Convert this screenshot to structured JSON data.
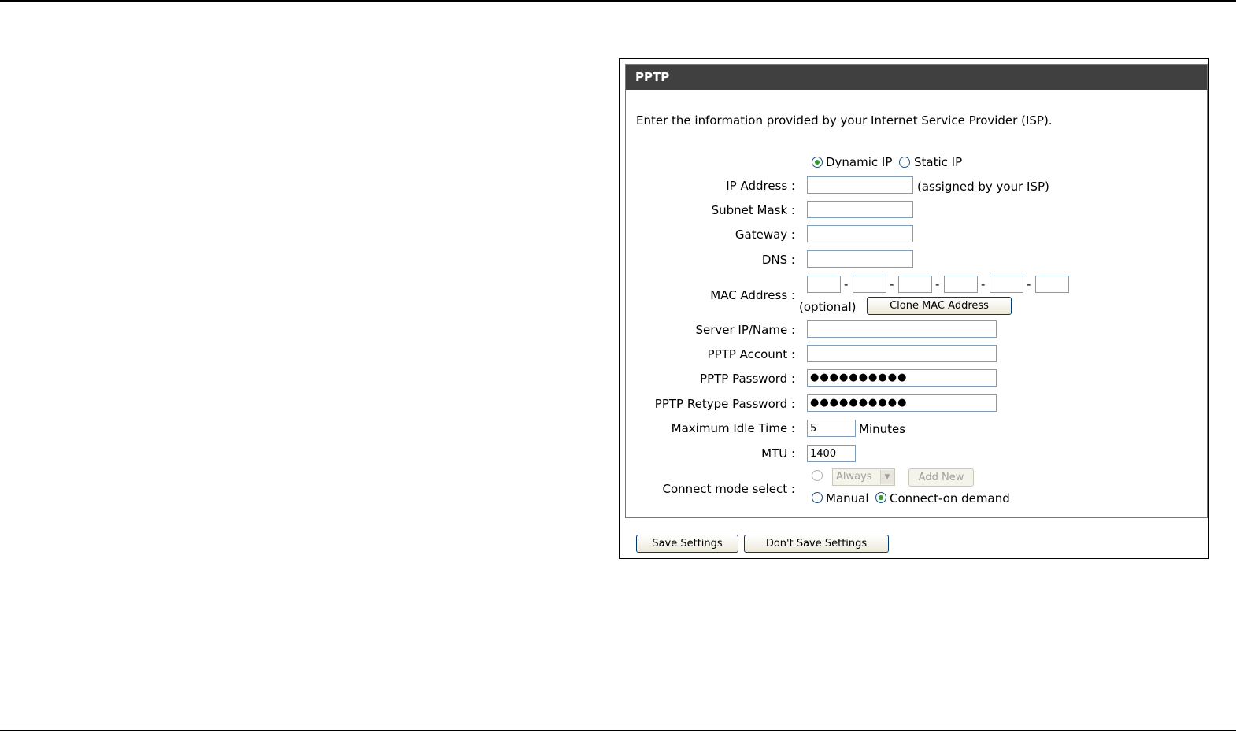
{
  "panel": {
    "title": "PPTP",
    "intro": "Enter the information provided by your Internet Service Provider (ISP)."
  },
  "ip_mode": {
    "dynamic_label": "Dynamic IP",
    "static_label": "Static IP",
    "selected": "dynamic"
  },
  "fields": {
    "ip_address_label": "IP Address :",
    "ip_address_value": "",
    "ip_address_hint": "(assigned by your ISP)",
    "subnet_mask_label": "Subnet Mask :",
    "subnet_mask_value": "",
    "gateway_label": "Gateway :",
    "gateway_value": "",
    "dns_label": "DNS :",
    "dns_value": "",
    "mac_label": "MAC Address :",
    "mac_separator": "-",
    "mac_optional": "(optional)",
    "clone_mac_label": "Clone MAC Address",
    "server_label": "Server IP/Name :",
    "server_value": "",
    "account_label": "PPTP Account :",
    "account_value": "",
    "password_label": "PPTP Password :",
    "password_mask": "●●●●●●●●●●",
    "retype_label": "PPTP Retype Password :",
    "retype_mask": "●●●●●●●●●●",
    "idle_label": "Maximum Idle Time :",
    "idle_value": "5",
    "idle_unit": "Minutes",
    "mtu_label": "MTU :",
    "mtu_value": "1400"
  },
  "connect_mode": {
    "label": "Connect mode select :",
    "schedule_selected": "Always",
    "add_new_label": "Add New",
    "manual_label": "Manual",
    "on_demand_label": "Connect-on demand",
    "selected": "on-demand"
  },
  "footer": {
    "save_label": "Save Settings",
    "dont_save_label": "Don't Save Settings"
  },
  "colors": {
    "header_bg": "#404040",
    "header_text": "#ffffff",
    "radio_dot": "#2f9a2f",
    "input_border": "#7f9db9"
  }
}
